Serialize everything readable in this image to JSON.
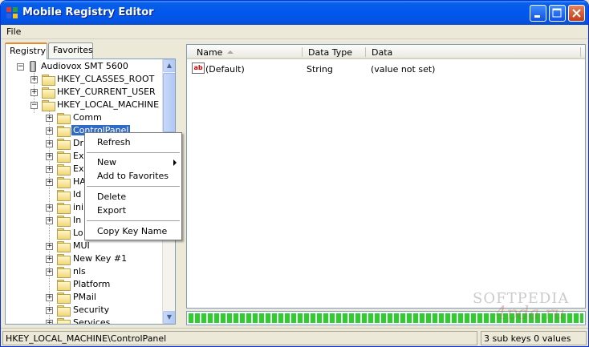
{
  "window": {
    "title": "Mobile Registry Editor",
    "minimize": "_",
    "maximize": "□",
    "close": "✕"
  },
  "menu": {
    "file": "File"
  },
  "tabs": {
    "registry": "Registry",
    "favorites": "Favorites"
  },
  "tree": {
    "root": "Audiovox SMT 5600",
    "hives": [
      "HKEY_CLASSES_ROOT",
      "HKEY_CURRENT_USER",
      "HKEY_LOCAL_MACHINE"
    ],
    "children": [
      "Comm",
      "ControlPanel",
      "Dr",
      "Ex",
      "Ex",
      "HA",
      "Id",
      "ini",
      "In",
      "Lo",
      "MUI",
      "New Key #1",
      "nls",
      "Platform",
      "PMail",
      "Security",
      "Services"
    ]
  },
  "list": {
    "headers": {
      "name": "Name",
      "type": "Data Type",
      "data": "Data"
    },
    "rows": [
      {
        "name": "(Default)",
        "type": "String",
        "data": "(value not set)"
      }
    ],
    "value_icon": "ab"
  },
  "progress": {
    "fraction": 1.0
  },
  "context_menu": {
    "refresh": "Refresh",
    "new": "New",
    "add_fav": "Add to Favorites",
    "delete": "Delete",
    "export": "Export",
    "copy_key_name": "Copy Key Name"
  },
  "status": {
    "path": "HKEY_LOCAL_MACHINE\\ControlPanel",
    "summary": "3 sub keys 0 values"
  },
  "watermark": {
    "line1": "SOFTPEDIA",
    "line2": "4pda.ru"
  },
  "colors": {
    "selection": "#316ac5",
    "progress": "#2cd02c",
    "title": "#0058ee"
  }
}
